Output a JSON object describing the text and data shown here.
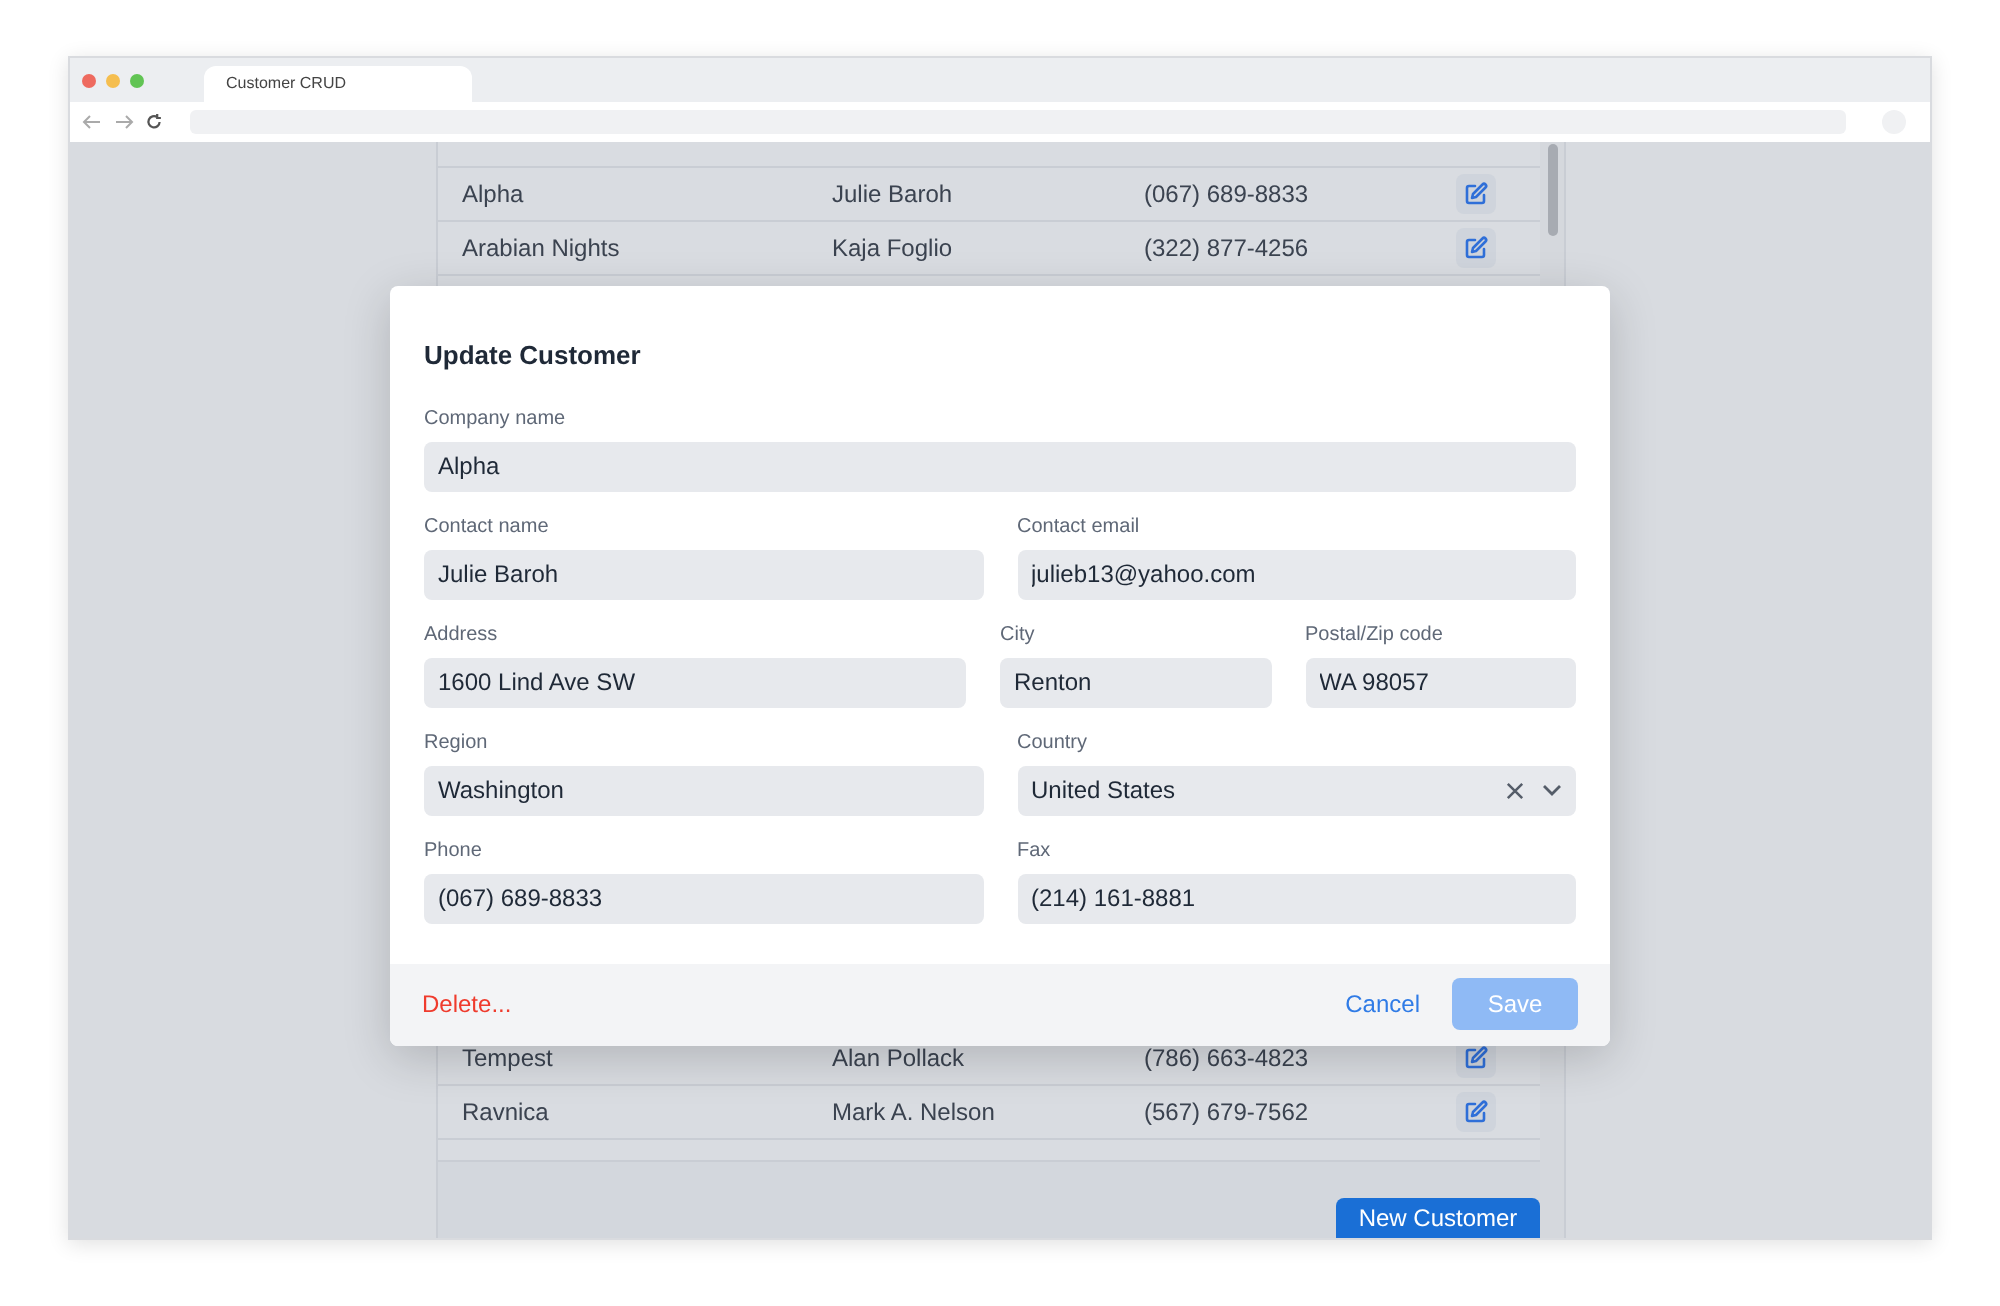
{
  "browser": {
    "tab_title": "Customer CRUD"
  },
  "table": {
    "rows_above": [
      {
        "company": "Alpha",
        "contact": "Julie Baroh",
        "phone": "(067) 689-8833"
      },
      {
        "company": "Arabian Nights",
        "contact": "Kaja Foglio",
        "phone": "(322) 877-4256"
      }
    ],
    "rows_below": [
      {
        "company": "Tempest",
        "contact": "Alan Pollack",
        "phone": "(786) 663-4823"
      },
      {
        "company": "Ravnica",
        "contact": "Mark A. Nelson",
        "phone": "(567) 679-7562"
      }
    ],
    "new_button": "New Customer"
  },
  "dialog": {
    "title": "Update Customer",
    "rows": [
      [
        {
          "label": "Company name",
          "value": "Alpha",
          "kind": "text"
        }
      ],
      [
        {
          "label": "Contact name",
          "value": "Julie Baroh",
          "kind": "text"
        },
        {
          "label": "Contact email",
          "value": "julieb13@yahoo.com",
          "kind": "text"
        }
      ],
      [
        {
          "label": "Address",
          "value": "1600 Lind Ave SW",
          "kind": "text"
        },
        {
          "label": "City",
          "value": "Renton",
          "kind": "text"
        },
        {
          "label": "Postal/Zip code",
          "value": "WA 98057",
          "kind": "text"
        }
      ],
      [
        {
          "label": "Region",
          "value": "Washington",
          "kind": "text"
        },
        {
          "label": "Country",
          "value": "United States",
          "kind": "select"
        }
      ],
      [
        {
          "label": "Phone",
          "value": "(067) 689-8833",
          "kind": "text"
        },
        {
          "label": "Fax",
          "value": "(214) 161-8881",
          "kind": "text"
        }
      ]
    ],
    "delete": "Delete...",
    "cancel": "Cancel",
    "save": {
      "label": "Save",
      "disabled": true
    }
  }
}
